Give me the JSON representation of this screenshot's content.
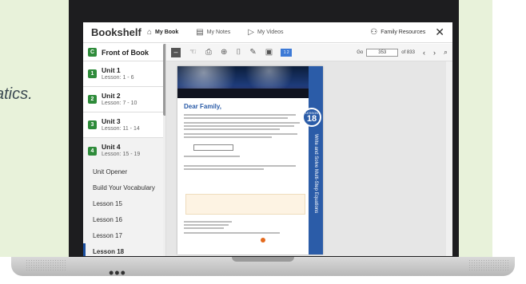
{
  "slogan_fragment": ",\natics.",
  "app": {
    "brand": "Bookshelf",
    "close_symbol": "✕"
  },
  "tabs": [
    {
      "label": "My Book",
      "icon": "book-open-icon",
      "active": true
    },
    {
      "label": "My Notes",
      "icon": "notes-icon",
      "active": false
    },
    {
      "label": "My Videos",
      "icon": "video-icon",
      "active": false
    }
  ],
  "family_resources": {
    "label": "Family Resources",
    "icon": "people-icon"
  },
  "sidebar": {
    "front": {
      "badge": "C",
      "label": "Front of Book"
    },
    "units": [
      {
        "badge": "1",
        "title": "Unit 1",
        "sub": "Lesson: 1 - 6"
      },
      {
        "badge": "2",
        "title": "Unit 2",
        "sub": "Lesson: 7 - 10"
      },
      {
        "badge": "3",
        "title": "Unit 3",
        "sub": "Lesson: 11 - 14"
      },
      {
        "badge": "4",
        "title": "Unit 4",
        "sub": "Lesson: 15 - 19"
      }
    ],
    "subitems": [
      {
        "label": "Unit Opener"
      },
      {
        "label": "Build Your Vocabulary"
      },
      {
        "label": "Lesson 15"
      },
      {
        "label": "Lesson 16"
      },
      {
        "label": "Lesson 17"
      },
      {
        "label": "Lesson 18"
      }
    ]
  },
  "toolbar": {
    "collapse": "–",
    "tools": [
      "pointer-icon",
      "print-icon",
      "zoom-icon",
      "bookmark-icon",
      "pen-icon",
      "note-icon"
    ],
    "page_layout_label": "1 2",
    "go_label": "Go",
    "page_value": "353",
    "page_total": "of 833",
    "prev": "‹",
    "next": "›",
    "search": "⌕"
  },
  "page": {
    "heading": "Dear Family,",
    "lesson_label": "LESSON",
    "lesson_number": "18",
    "side_title": "Write and Solve Multi-Step Equations"
  },
  "colors": {
    "green_bg": "#e8f2da",
    "badge_green": "#2e8b3a",
    "accent_blue": "#2b5ca8"
  }
}
